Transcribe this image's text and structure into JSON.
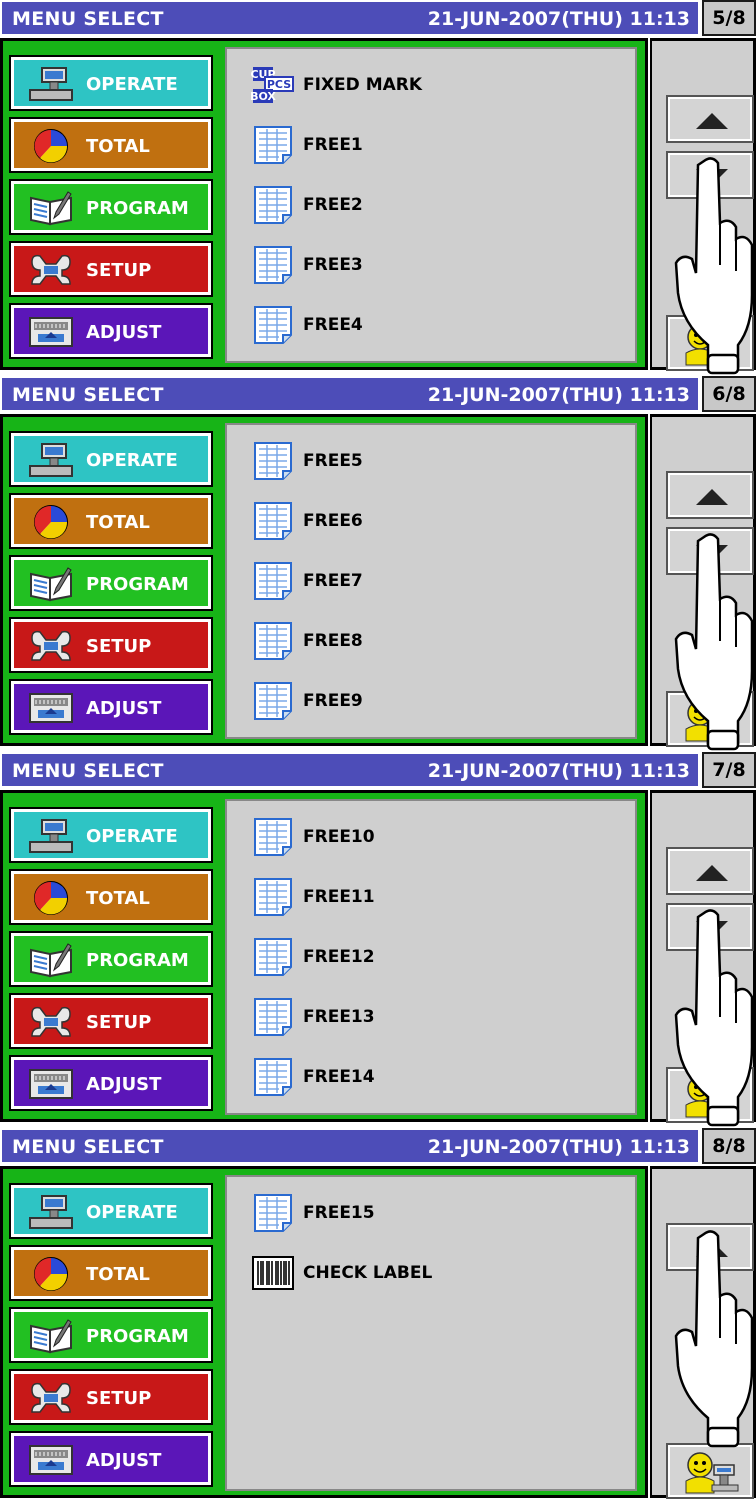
{
  "menu": {
    "title": "MENU SELECT",
    "datetime": "21-JUN-2007(THU) 11:13",
    "buttons": [
      "OPERATE",
      "TOTAL",
      "PROGRAM",
      "SETUP",
      "ADJUST"
    ]
  },
  "screens": [
    {
      "page": "5/8",
      "items": [
        "FIXED MARK",
        "FREE1",
        "FREE2",
        "FREE3",
        "FREE4"
      ]
    },
    {
      "page": "6/8",
      "items": [
        "FREE5",
        "FREE6",
        "FREE7",
        "FREE8",
        "FREE9"
      ]
    },
    {
      "page": "7/8",
      "items": [
        "FREE10",
        "FREE11",
        "FREE12",
        "FREE13",
        "FREE14"
      ]
    },
    {
      "page": "8/8",
      "items": [
        "FREE15",
        "CHECK LABEL"
      ]
    }
  ],
  "icons": {
    "fixed_mark_text": [
      "CUP",
      "PCS",
      "BOX"
    ]
  },
  "colors": {
    "titlebar": "#4d4db8",
    "frame": "#17b417",
    "operate": "#2ec4c4",
    "total": "#c07010",
    "program": "#22c022",
    "setup": "#c81818",
    "adjust": "#5b16b8"
  }
}
